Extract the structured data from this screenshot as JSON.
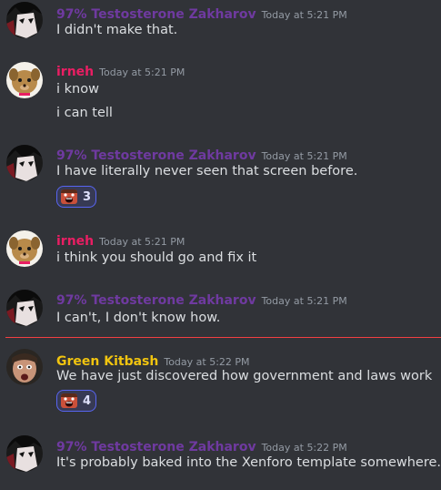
{
  "colors": {
    "background": "#313338",
    "zakharov": "#6f3aa0",
    "irneh": "#e91e63",
    "kitbash": "#f1c40f",
    "timestamp": "#949ba4",
    "text": "#dbdee1",
    "reaction_border": "#5865f2",
    "divider": "#f23f42"
  },
  "messages": [
    {
      "author": "97% Testosterone Zakharov",
      "timestamp": "Today at 5:21 PM",
      "lines": [
        "I didn't make that."
      ],
      "avatar_icon": "anime-avatar-icon"
    },
    {
      "author": "irneh",
      "timestamp": "Today at 5:21 PM",
      "lines": [
        "i know",
        "i can tell"
      ],
      "avatar_icon": "dog-avatar-icon"
    },
    {
      "author": "97% Testosterone Zakharov",
      "timestamp": "Today at 5:21 PM",
      "lines": [
        "I have literally never seen that screen before."
      ],
      "reaction": {
        "emoji": "screaming-face-emoji",
        "count": "3"
      }
    },
    {
      "author": "irneh",
      "timestamp": "Today at 5:21 PM",
      "lines": [
        "i think you should go and fix it"
      ]
    },
    {
      "author": "97% Testosterone Zakharov",
      "timestamp": "Today at 5:21 PM",
      "lines": [
        "I can't, I don't know how."
      ]
    },
    {
      "author": "Green Kitbash",
      "timestamp": "Today at 5:22 PM",
      "lines": [
        "We have just discovered how government and laws work"
      ],
      "reaction": {
        "emoji": "screaming-face-emoji",
        "count": "4"
      }
    },
    {
      "author": "97% Testosterone Zakharov",
      "timestamp": "Today at 5:22 PM",
      "lines": [
        "It's probably baked into the Xenforo template somewhere."
      ]
    }
  ]
}
